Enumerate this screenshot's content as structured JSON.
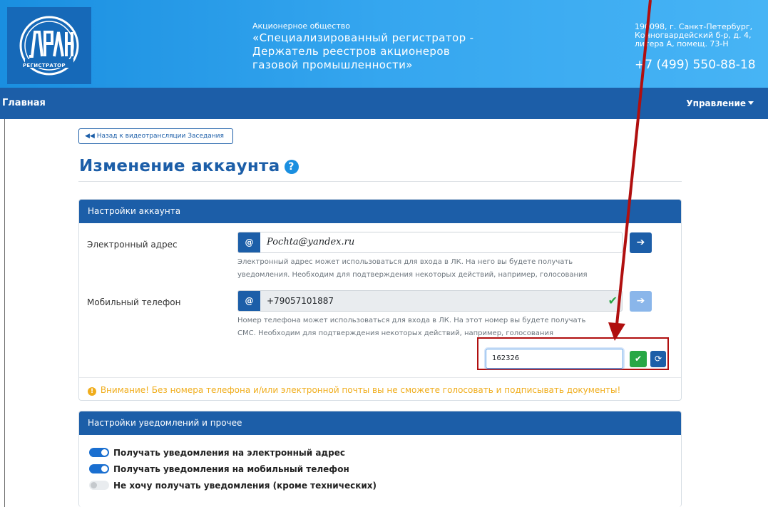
{
  "header": {
    "logo_text": "ДРАГА РЕГИСТРАТОР",
    "company_small": "Акционерное общество",
    "company_lines": [
      "«Специализированный регистратор -",
      "Держатель реестров акционеров",
      "газовой промышленности»"
    ],
    "address_lines": [
      "190098, г. Санкт-Петербург,",
      "Конногвардейский б-р, д. 4,",
      "литера А, помещ. 73-Н"
    ],
    "phone": "+7 (499) 550-88-18"
  },
  "navbar": {
    "home": "Главная",
    "manage": "Управление"
  },
  "back_button": "◀◀ Назад к видеотрансляции Заседания",
  "page_title": "Изменение аккаунта",
  "account_card": {
    "title": "Настройки аккаунта",
    "email": {
      "label": "Электронный адрес",
      "value": "Pochta@yandex.ru",
      "help": [
        "Электронный адрес может использоваться для входа в ЛК. На него вы будете получать",
        "уведомления. Необходим для подтверждения некоторых действий, например, голосования"
      ]
    },
    "phone": {
      "label": "Мобильный телефон",
      "value": "+79057101887",
      "help": [
        "Номер телефона может использоваться для входа в ЛК. На этот номер вы будете получать",
        "СМС. Необходим для подтверждения некоторых действий, например, голосования"
      ]
    },
    "code_value": "162326",
    "warning": "Внимание! Без номера телефона и/или электронной почты вы не сможете голосовать и подписывать документы!"
  },
  "notify_card": {
    "title": "Настройки уведомлений и прочее",
    "toggles": [
      {
        "label": "Получать уведомления на электронный адрес",
        "on": true
      },
      {
        "label": "Получать уведомления на мобильный телефон",
        "on": true
      },
      {
        "label": "Не хочу получать уведомления (кроме технических)",
        "on": false
      }
    ]
  },
  "colors": {
    "primary": "#1c5ea8",
    "header_gradient_start": "#1a8fe0",
    "success": "#28a745",
    "warning": "#f0ad1c",
    "annotation": "#b00f0f"
  }
}
